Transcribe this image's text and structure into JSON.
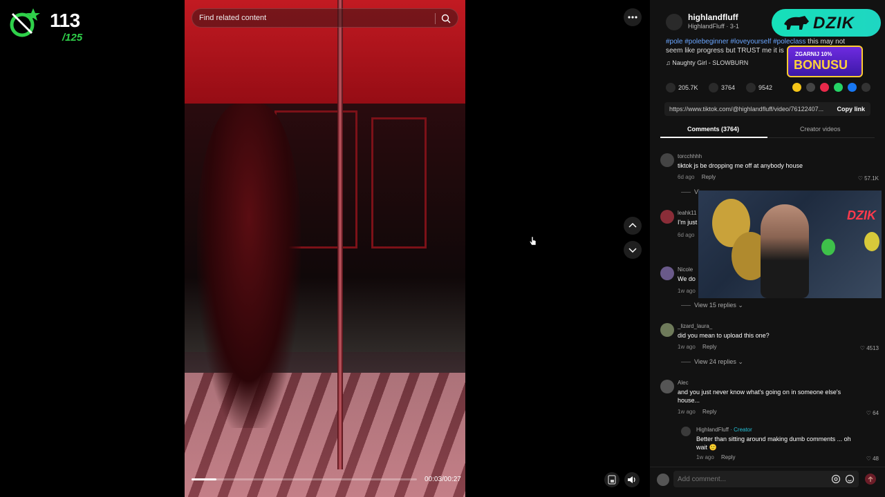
{
  "overlay": {
    "count": "113",
    "total": "/125"
  },
  "video": {
    "search_placeholder": "Find related content",
    "progress": 0.11,
    "time": "00:03/00:27"
  },
  "author": {
    "name": "highlandfluff",
    "subtitle": "HighlandFluff · 3-1",
    "description_tags": [
      "#pole",
      "#polebeginner",
      "#loveyourself",
      "#poleclass"
    ],
    "description_text": "this may not seem like progress but TRUST me it is",
    "music": "Naughty Girl - SLOWBURN"
  },
  "stats": {
    "likes": "205.7K",
    "comments": "3764",
    "saves": "9542"
  },
  "link": {
    "url": "https://www.tiktok.com/@highlandfluff/video/76122407...",
    "copy_label": "Copy link"
  },
  "tabs": {
    "comments": "Comments (3764)",
    "creator": "Creator videos"
  },
  "comments": [
    {
      "user": "torcchhhh",
      "text": "tiktok js be dropping me off at anybody house",
      "time": "6d ago",
      "reply": "Reply",
      "likes": "57.1K"
    },
    {
      "user": "leahk11",
      "text": "I'm just",
      "time": "6d ago",
      "reply": "Reply",
      "likes": ""
    },
    {
      "user": "Nicole",
      "text": "We do",
      "time": "1w ago",
      "reply": "Reply",
      "likes": ""
    },
    {
      "user": "_lizard_laura_",
      "text": "did you mean to upload this one?",
      "time": "1w ago",
      "reply": "Reply",
      "likes": "4513"
    },
    {
      "user": "Alec",
      "text": "and you just never know what's going on in someone else's house...",
      "time": "1w ago",
      "reply": "Reply",
      "likes": "64"
    }
  ],
  "view_replies": {
    "first": "View 15 replies",
    "second": "View 24 replies",
    "partial": "View"
  },
  "creator_reply": {
    "user": "HighlandFluff",
    "badge": "· Creator",
    "text": "Better than sitting around making dumb comments ... oh wait 🙂",
    "time": "1w ago",
    "reply": "Reply",
    "likes": "48"
  },
  "add_comment": {
    "placeholder": "Add comment..."
  },
  "ads": {
    "dzik": "DZIK",
    "bonus_top": "ZGARNIJ 10%",
    "bonus_bottom": "BONUSU",
    "webcam_brand": "DZIK"
  },
  "colors": {
    "accent_teal": "#16e0b9",
    "creator": "#25c2d8",
    "tag": "#6aa6ff",
    "counter_green": "#2fd14a"
  }
}
